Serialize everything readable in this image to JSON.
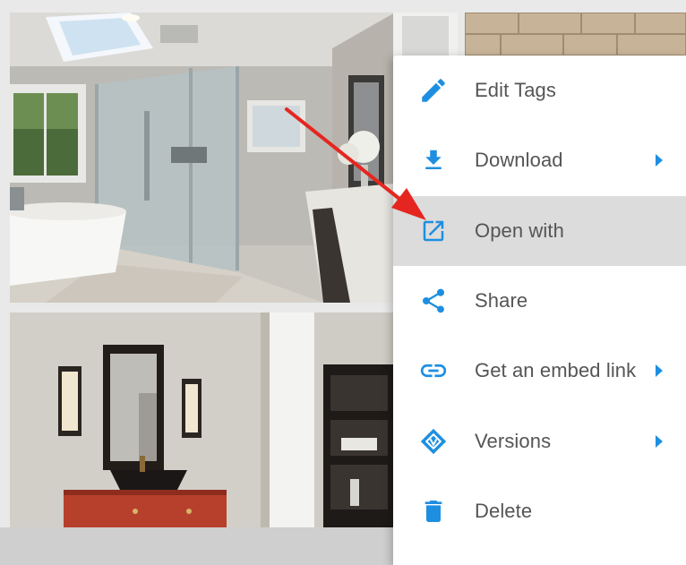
{
  "colors": {
    "accent": "#1e8fe0",
    "annotation_arrow": "#e52620",
    "menu_text": "#555555",
    "menu_hover": "#dcdcdc"
  },
  "gallery": {
    "tiles": [
      {
        "subject": "bathroom-glass-shower-photo"
      },
      {
        "subject": "stone-tile-wall-photo"
      },
      {
        "subject": "bathroom-vanity-red-cabinet-photo"
      }
    ]
  },
  "context_menu": {
    "items": [
      {
        "label": "Edit Tags",
        "icon": "pencil-icon",
        "submenu": false,
        "active": false
      },
      {
        "label": "Download",
        "icon": "download-icon",
        "submenu": true,
        "active": false
      },
      {
        "label": "Open with",
        "icon": "open-external-icon",
        "submenu": false,
        "active": true
      },
      {
        "label": "Share",
        "icon": "share-icon",
        "submenu": false,
        "active": false
      },
      {
        "label": "Get an embed link",
        "icon": "link-icon",
        "submenu": true,
        "active": false
      },
      {
        "label": "Versions",
        "icon": "versions-icon",
        "submenu": true,
        "active": false
      },
      {
        "label": "Delete",
        "icon": "trash-icon",
        "submenu": false,
        "active": false
      }
    ]
  }
}
